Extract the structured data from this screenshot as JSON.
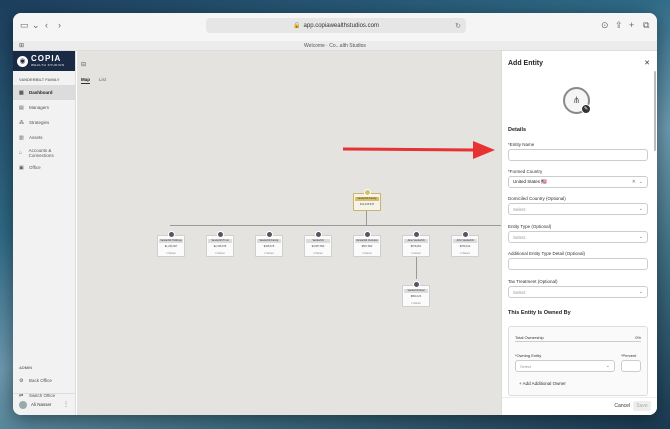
{
  "browser": {
    "url": "app.copiawealthstudios.com",
    "tab_title": "Welcome · Co...alth Studios"
  },
  "brand": {
    "name": "COPIA",
    "tagline": "WEALTH STUDIOS",
    "navy": "#1b2a44"
  },
  "sidebar": {
    "section": "VANDERBILT FAMILY",
    "items": [
      {
        "label": "Dashboard",
        "icon": "grid-icon"
      },
      {
        "label": "Managers",
        "icon": "id-card-icon"
      },
      {
        "label": "Strategies",
        "icon": "network-icon"
      },
      {
        "label": "Assets",
        "icon": "bar-chart-icon"
      },
      {
        "label": "Accounts & Connections",
        "icon": "bank-icon"
      },
      {
        "label": "Office",
        "icon": "briefcase-icon"
      }
    ],
    "admin_label": "ADMIN",
    "admin_items": [
      {
        "label": "Back Office",
        "icon": "gear-icon"
      },
      {
        "label": "Switch Office",
        "icon": "swap-icon"
      }
    ],
    "user": "Ali Nasser"
  },
  "main": {
    "tabs": [
      "Map",
      "List"
    ],
    "root_node": {
      "name": "Vanderbilt Family",
      "value": "$12,345,678"
    },
    "nodes": [
      {
        "name": "Vanderbilt Holdings LLC",
        "value": "$1,234,567",
        "owned": "1 Owner"
      },
      {
        "name": "Vanderbilt Trust",
        "value": "$2,345,678",
        "owned": "1 Owner"
      },
      {
        "name": "Vanderbilt Family Office",
        "value": "$345,678",
        "owned": "1 Owner"
      },
      {
        "name": "Vanderbilt Foundation",
        "value": "$4,567,890",
        "owned": "1 Owner"
      },
      {
        "name": "Vanderbilt Ventures LP",
        "value": "$567,890",
        "owned": "1 Owner"
      },
      {
        "name": "Jane Vanderbilt",
        "value": "$678,901",
        "owned": "1 Owner"
      },
      {
        "name": "John Vanderbilt",
        "value": "$789,012",
        "owned": "1 Owner"
      }
    ],
    "child_node": {
      "name": "Vanderbilt Real Estate",
      "value": "$890,123",
      "owned": "1 Owner"
    },
    "arrow_color": "#e63232"
  },
  "panel": {
    "title": "Add Entity",
    "details_heading": "Details",
    "entity_name_label": "*Entity Name",
    "formed_country_label": "*Formed Country",
    "formed_country_value": "United States 🇺🇸",
    "domiciled_label": "Domiciled Country (Optional)",
    "domiciled_placeholder": "Select",
    "entity_type_label": "Entity Type (Optional)",
    "entity_type_placeholder": "Select",
    "entity_type_detail_label": "Additional Entity Type Detail (Optional)",
    "tax_label": "Tax Treatment (Optional)",
    "tax_placeholder": "Select",
    "owned_by_heading": "This Entity Is Owned By",
    "total_ownership_label": "Total Ownership",
    "total_ownership_value": "0%",
    "owning_entity_label": "*Owning Entity",
    "percent_label": "*Percent",
    "owning_entity_placeholder": "Select",
    "add_owner_label": "Add Additional Owner",
    "cancel_label": "Cancel",
    "save_label": "Save"
  }
}
